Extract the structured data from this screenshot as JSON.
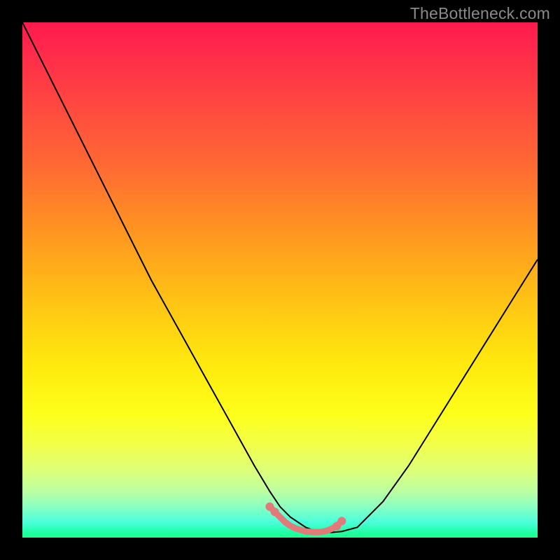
{
  "watermark": "TheBottleneck.com",
  "chart_data": {
    "type": "line",
    "title": "",
    "xlabel": "",
    "ylabel": "",
    "xlim": [
      0,
      100
    ],
    "ylim": [
      0,
      100
    ],
    "grid": false,
    "series": [
      {
        "name": "bottleneck-curve",
        "color": "#000000",
        "x": [
          0,
          5,
          10,
          15,
          20,
          25,
          30,
          35,
          40,
          45,
          48,
          50,
          52,
          55,
          57,
          60,
          62,
          65,
          70,
          75,
          80,
          85,
          90,
          95,
          100
        ],
        "values": [
          100,
          90,
          80,
          70,
          60,
          50,
          41,
          32,
          23,
          14,
          9,
          6,
          4,
          2,
          1.2,
          1,
          1.2,
          2,
          7,
          14,
          22,
          30,
          38,
          46,
          54
        ],
        "comment": "approximate V-shape; y is % bottleneck, 0 at bottom"
      }
    ],
    "highlight": {
      "name": "optimal-range",
      "color": "#e27a7a",
      "x": [
        48,
        49,
        50,
        51,
        52,
        53,
        54,
        55,
        56,
        57,
        58,
        59,
        60,
        61,
        62
      ],
      "values": [
        6,
        5,
        4,
        3,
        2.3,
        1.8,
        1.5,
        1.2,
        1.1,
        1.05,
        1.1,
        1.3,
        1.7,
        2.2,
        3.2
      ]
    },
    "colors": {
      "gradient_top": "#ff1a4d",
      "gradient_mid": "#ffe80d",
      "gradient_bottom": "#1aff8c",
      "curve": "#000000",
      "highlight": "#e27a7a",
      "frame": "#000000"
    }
  }
}
